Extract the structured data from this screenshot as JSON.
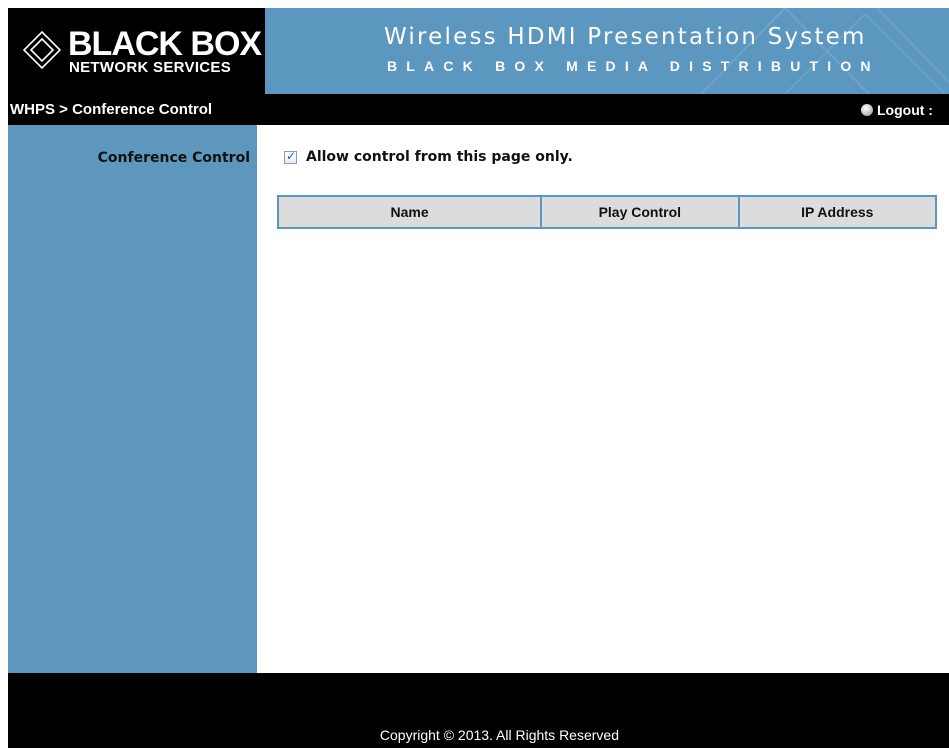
{
  "header": {
    "logo": {
      "brand": "BLACK BOX",
      "tagline": "NETWORK SERVICES"
    },
    "title": "Wireless HDMI Presentation System",
    "subtitle": "BLACK BOX MEDIA DISTRIBUTION",
    "colors": {
      "banner": "#5c97bf",
      "logo_background": "#000000"
    }
  },
  "navbar": {
    "breadcrumb": "WHPS > Conference Control",
    "logout_label": "Logout :",
    "logout_icon": "globe-icon"
  },
  "sidebar": {
    "section_label": "Conference Control",
    "color": "#5e97bd"
  },
  "main": {
    "allow_control": {
      "checked": true,
      "label": "Allow control from this page only."
    },
    "table": {
      "columns": [
        "Name",
        "Play Control",
        "IP Address"
      ],
      "rows": []
    }
  },
  "footer": {
    "copyright": "Copyright © 2013. All Rights Reserved"
  }
}
